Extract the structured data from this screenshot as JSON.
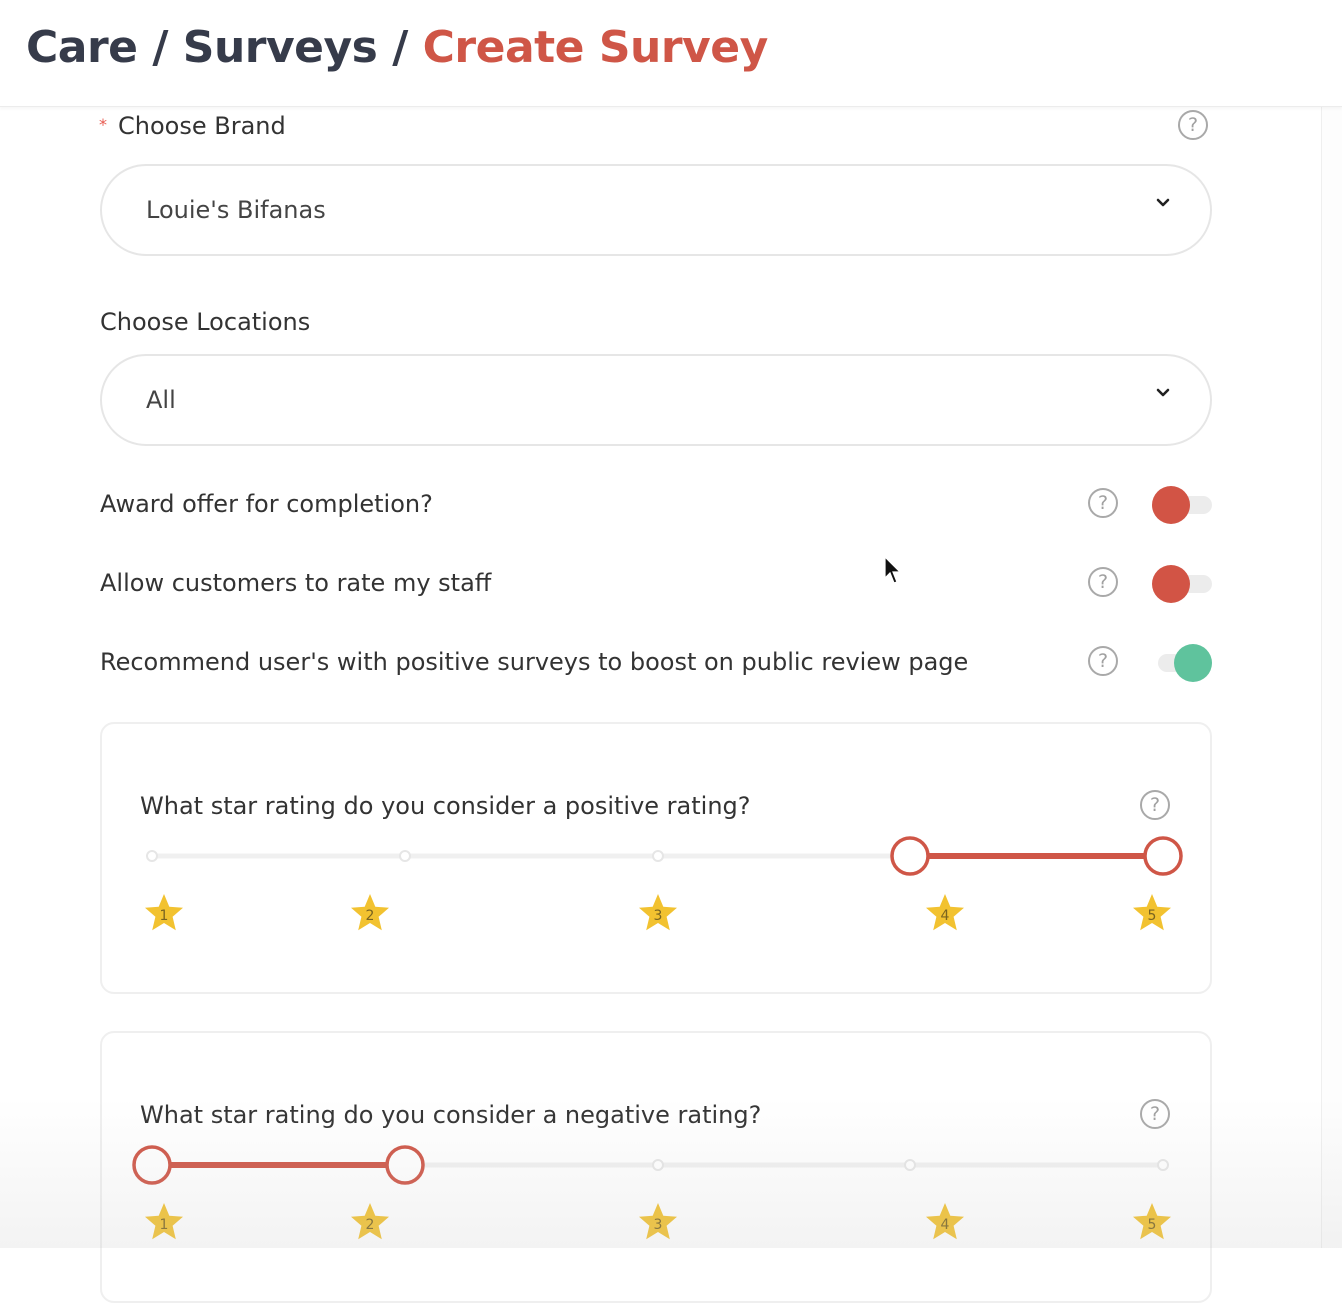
{
  "breadcrumb": {
    "items": [
      "Care",
      "Surveys",
      "Create Survey"
    ],
    "separator": "/"
  },
  "brand": {
    "label": "Choose Brand",
    "required_mark": "*",
    "value": "Louie's Bifanas"
  },
  "locations": {
    "label": "Choose Locations",
    "value": "All"
  },
  "toggles": [
    {
      "label": "Award offer for completion?",
      "state": "off"
    },
    {
      "label": "Allow customers to rate my staff",
      "state": "off"
    },
    {
      "label": "Recommend user's with positive surveys to boost on public review page",
      "state": "on"
    }
  ],
  "positive_rating": {
    "question": "What star rating do you consider a positive rating?",
    "range": [
      4,
      5
    ],
    "stars": [
      "1",
      "2",
      "3",
      "4",
      "5"
    ]
  },
  "negative_rating": {
    "question": "What star rating do you consider a negative rating?",
    "range": [
      1,
      2
    ],
    "stars": [
      "1",
      "2",
      "3",
      "4",
      "5"
    ]
  },
  "help_glyph": "?",
  "colors": {
    "breadcrumb_dark": "#363b4a",
    "accent_red": "#cf5647",
    "toggle_on": "#5fc39d",
    "star": "#f2c230"
  }
}
